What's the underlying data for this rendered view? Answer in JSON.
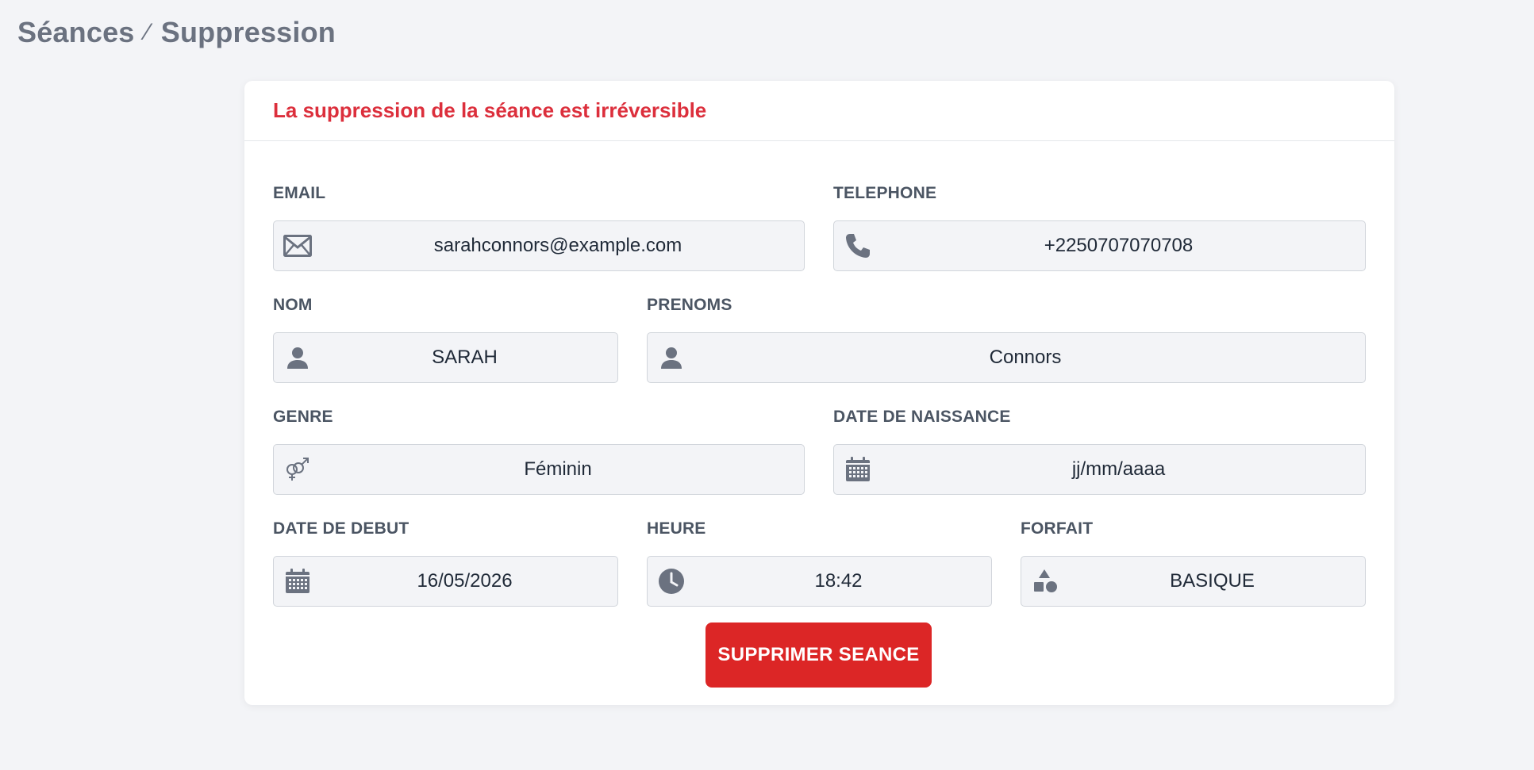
{
  "breadcrumb": {
    "section": "Séances",
    "separator": "⁄",
    "page": "Suppression"
  },
  "card": {
    "title": "La suppression de la séance est irréversible"
  },
  "fields": {
    "email": {
      "label": "EMAIL",
      "value": "sarahconnors@example.com",
      "icon": "envelope-icon"
    },
    "telephone": {
      "label": "TELEPHONE",
      "value": "+2250707070708",
      "icon": "phone-icon"
    },
    "nom": {
      "label": "NOM",
      "value": "SARAH",
      "icon": "user-icon"
    },
    "prenoms": {
      "label": "PRENOMS",
      "value": "Connors",
      "icon": "user-icon"
    },
    "genre": {
      "label": "GENRE",
      "value": "Féminin",
      "icon": "gender-icon"
    },
    "date_naissance": {
      "label": "DATE DE NAISSANCE",
      "value": "jj/mm/aaaa",
      "icon": "calendar-icon"
    },
    "date_debut": {
      "label": "DATE DE DEBUT",
      "value": "16/05/2026",
      "icon": "calendar-icon"
    },
    "heure": {
      "label": "HEURE",
      "value": "18:42",
      "icon": "clock-icon"
    },
    "forfait": {
      "label": "FORFAIT",
      "value": "BASIQUE",
      "icon": "shapes-icon"
    }
  },
  "actions": {
    "delete_label": "SUPPRIMER SEANCE"
  },
  "colors": {
    "accent_danger": "#dc2626",
    "title_danger": "#dc2f3c",
    "icon_gray": "#6b7280",
    "background": "#f3f4f7"
  }
}
